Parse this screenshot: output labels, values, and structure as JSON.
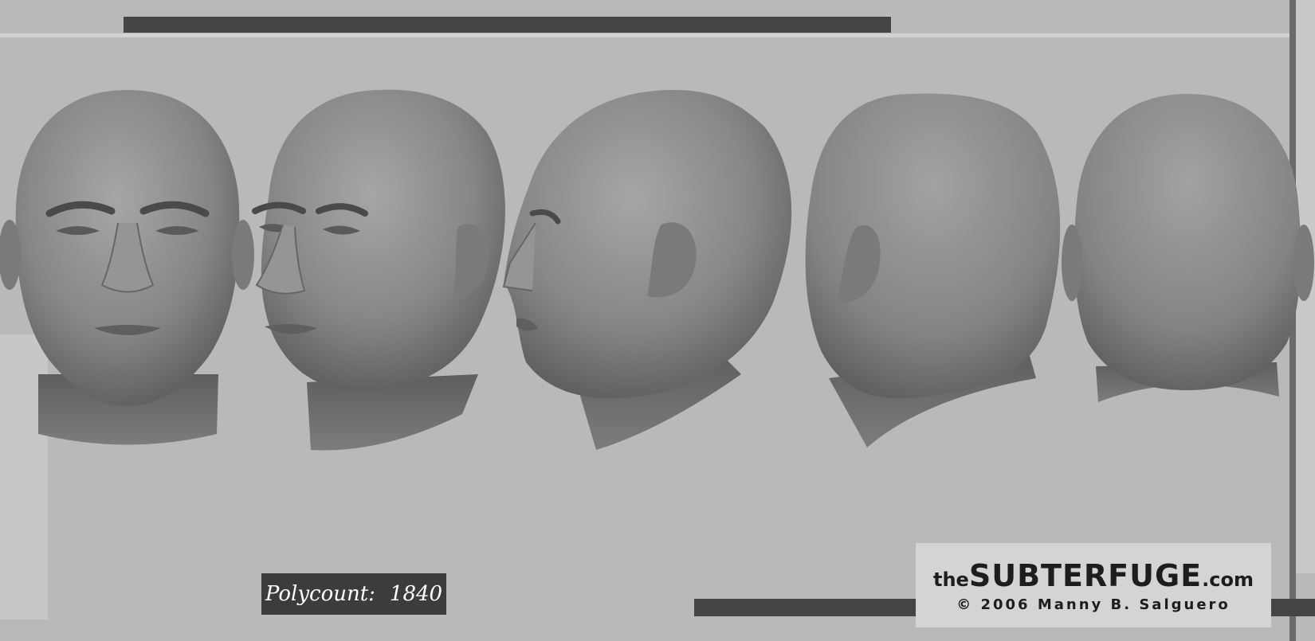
{
  "polycount": {
    "label": "Polycount:",
    "value": "1840"
  },
  "logo": {
    "prefix": "the",
    "name": "SUBTERFUGE",
    "suffix": ".com"
  },
  "copyright": "© 2006 Manny B. Salguero",
  "colors": {
    "background": "#b9b9b9",
    "dark_bar": "#444444",
    "head_mid": "#8a8a8a",
    "head_dark": "#555555",
    "badge_bg": "#3c3c3c",
    "logo_bg": "#d4d4d4"
  },
  "head_views": [
    "front-view",
    "three-quarter-front-view",
    "side-view",
    "three-quarter-back-view",
    "back-view"
  ]
}
